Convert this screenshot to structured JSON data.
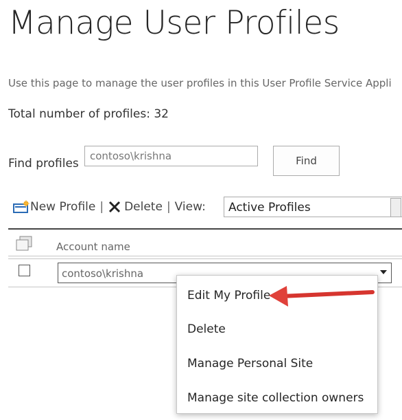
{
  "page": {
    "title": "Manage User Profiles",
    "description": "Use this page to manage the user profiles in this User Profile Service Appli",
    "total_profiles": "Total number of profiles: 32"
  },
  "find": {
    "label": "Find profiles",
    "input_value": "contoso\\krishna",
    "button_label": "Find"
  },
  "toolbar": {
    "new_profile_label": "New Profile",
    "delete_label": "Delete",
    "view_label": "View:",
    "view_selected": "Active Profiles",
    "separator": "|"
  },
  "table": {
    "columns": [
      "Account name"
    ],
    "rows": [
      {
        "account": "contoso\\krishna"
      }
    ]
  },
  "context_menu": {
    "items": [
      "Edit My Profile",
      "Delete",
      "Manage Personal Site",
      "Manage site collection owners"
    ]
  },
  "colors": {
    "arrow": "#e0413a",
    "text": "#262626",
    "muted": "#666666",
    "new_icon_blue": "#2a6bb5",
    "new_icon_star": "#f2a31b"
  },
  "icons": {
    "new_profile": "new-document-icon",
    "delete": "x-icon",
    "select_all": "select-all-icon",
    "dropdown": "chevron-down-icon"
  }
}
